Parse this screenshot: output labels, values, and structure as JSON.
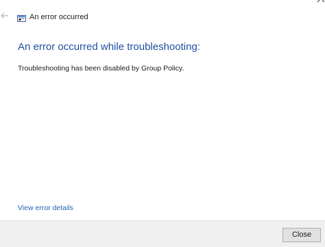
{
  "window": {
    "title": "An error occurred"
  },
  "content": {
    "heading": "An error occurred while troubleshooting:",
    "message": "Troubleshooting has been disabled by Group Policy.",
    "details_link": "View error details"
  },
  "footer": {
    "close_label": "Close"
  },
  "icons": {
    "back": "back-arrow-icon",
    "app": "troubleshooter-icon",
    "close": "close-icon"
  },
  "colors": {
    "heading": "#1f4fa0",
    "link": "#1f5fb8",
    "footer_bg": "#f0f0f0"
  }
}
